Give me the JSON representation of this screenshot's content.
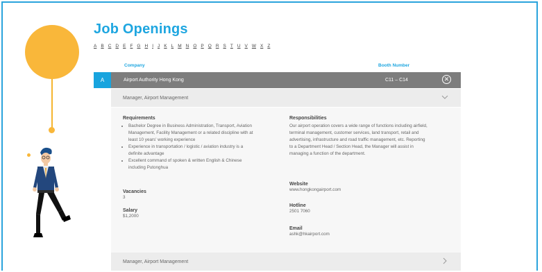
{
  "header": {
    "title": "Job Openings"
  },
  "alphabet": [
    "A",
    "B",
    "C",
    "D",
    "E",
    "F",
    "G",
    "H",
    "I",
    "J",
    "K",
    "L",
    "M",
    "N",
    "O",
    "P",
    "Q",
    "R",
    "S",
    "T",
    "U",
    "V",
    "W",
    "X",
    "Z"
  ],
  "columns": {
    "company": "Company",
    "booth": "Booth Number"
  },
  "listing": {
    "letter": "A",
    "company": "Airport Authority Hong Kong",
    "booth": "C11 – C14"
  },
  "jobs": [
    {
      "title": "Manager, Airport Management",
      "requirements_label": "Requirements",
      "requirements": [
        "Bachelor Degree in Business Administration, Transport, Aviation Management, Facility Management or a related discipline with at least 10 years' working experience",
        "Experience in transportation / logistic / aviation industry is a definite advantage",
        "Excellent command of spoken & written English & Chinese including Putonghua"
      ],
      "vacancies_label": "Vacancies",
      "vacancies": "3",
      "salary_label": "Salary",
      "salary": "$1,2000",
      "responsibilities_label": "Responsibilities",
      "responsibilities": "Our airport operation covers a wide range of functions including airfield, terminal management, customer services, land transport, retail and advertising, infrastructure and road traffic management, etc. Reporting to a Department Head / Section Head, the Manager will assist in managing a function of the department.",
      "website_label": "Website",
      "website": "www.hongkongairport.com",
      "hotline_label": "Hotline",
      "hotline": "2501 7060",
      "email_label": "Email",
      "email": "ashk@hkairport.com"
    },
    {
      "title": "Manager, Airport Management"
    }
  ],
  "colors": {
    "accent": "#1ea6e0",
    "bar": "#7d7d7d",
    "balloon": "#f9b73a"
  }
}
